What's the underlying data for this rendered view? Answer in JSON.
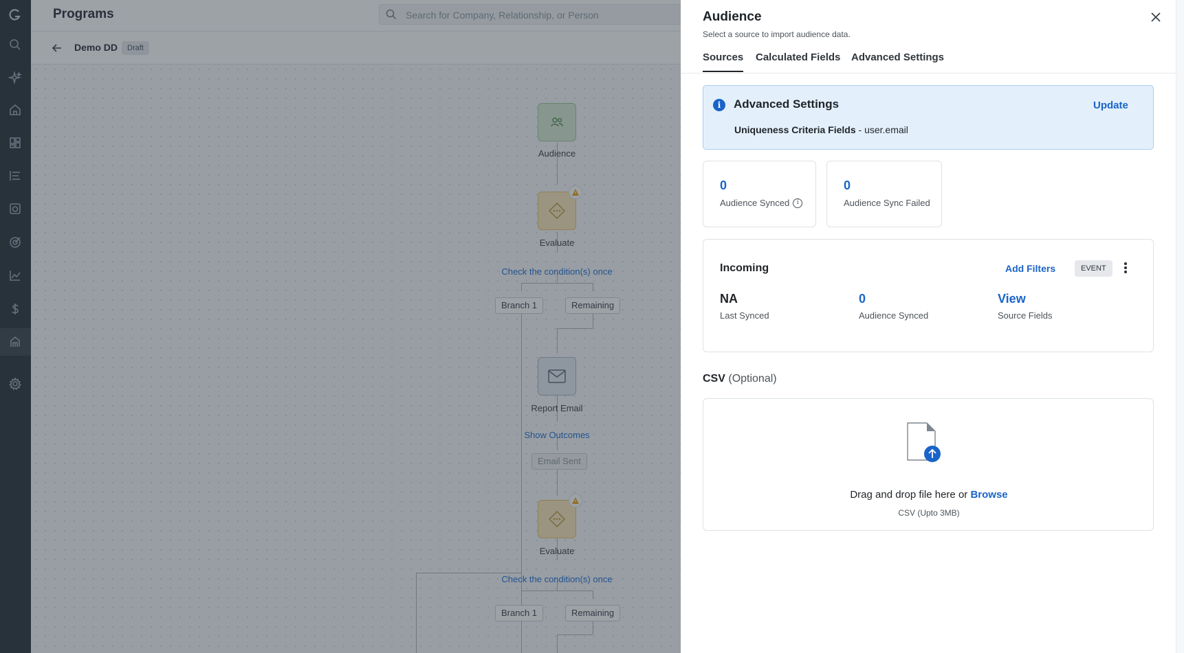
{
  "left_nav": {
    "icons": [
      "logo-icon",
      "search-icon",
      "sparkle-icon",
      "home-icon",
      "dashboard-icon",
      "timeline-icon",
      "calendar-icon",
      "target-icon",
      "chart-icon",
      "dollar-icon",
      "journey-icon",
      "settings-icon"
    ]
  },
  "app": {
    "title": "Programs",
    "search_placeholder": "Search for Company, Relationship, or Person",
    "program_name": "Demo DD",
    "program_status": "Draft"
  },
  "canvas": {
    "audience_label": "Audience",
    "evaluate_label_1": "Evaluate",
    "check_link_1": "Check the condition(s) once",
    "branch_1_a": "Branch 1",
    "remaining_a": "Remaining",
    "report_email_label": "Report Email",
    "show_outcomes_link": "Show Outcomes",
    "email_sent_pill": "Email Sent",
    "evaluate_label_2": "Evaluate",
    "check_link_2": "Check the condition(s) once",
    "branch_1_b": "Branch 1",
    "remaining_b": "Remaining"
  },
  "panel": {
    "title": "Audience",
    "subtitle": "Select a source to import audience data.",
    "tabs": [
      {
        "label": "Sources",
        "active": true
      },
      {
        "label": "Calculated Fields",
        "active": false
      },
      {
        "label": "Advanced Settings",
        "active": false
      }
    ],
    "advanced": {
      "heading": "Advanced Settings",
      "update_label": "Update",
      "uniqueness_label": "Uniqueness Criteria Fields",
      "uniqueness_sep": " - ",
      "uniqueness_value": "user.email"
    },
    "stats": [
      {
        "value": "0",
        "label": "Audience Synced"
      },
      {
        "value": "0",
        "label": "Audience Sync Failed"
      }
    ],
    "incoming": {
      "heading": "Incoming",
      "add_filters_label": "Add Filters",
      "event_badge": "EVENT",
      "columns": [
        {
          "value": "NA",
          "label": "Last Synced"
        },
        {
          "value": "0",
          "label": "Audience Synced"
        },
        {
          "value": "View",
          "label": "Source Fields"
        }
      ]
    },
    "csv": {
      "heading": "CSV",
      "optional": "(Optional)",
      "drop_text": "Drag and drop file here or",
      "browse_label": "Browse",
      "hint": "CSV (Upto 3MB)"
    }
  },
  "colors": {
    "accent": "#1a64c8",
    "nav_bg": "#2b333b",
    "info_bg": "#e3f0fb"
  }
}
